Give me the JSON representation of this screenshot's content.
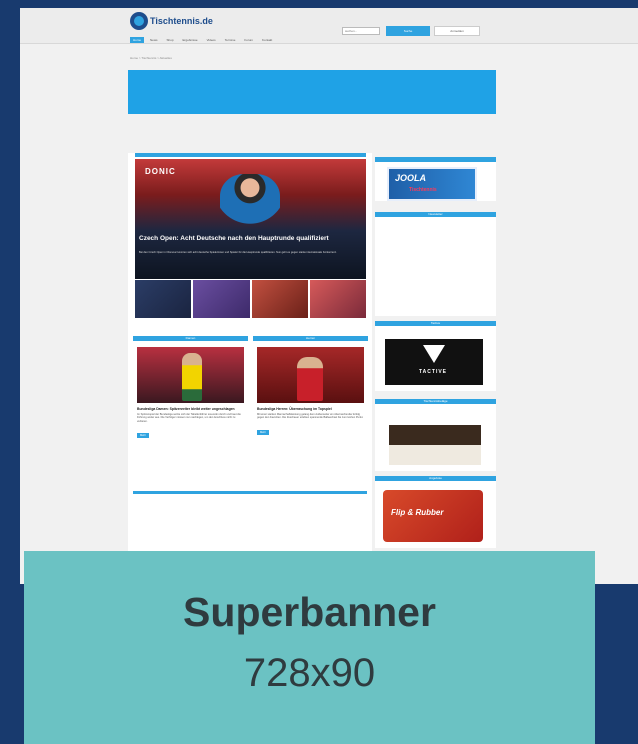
{
  "site": {
    "logo_text": "Tischtennis.de",
    "search_placeholder": "suchen...",
    "search_button": "Suche",
    "login_button": "Anmelden",
    "nav": [
      "Home",
      "News",
      "Shop",
      "Ergebnisse",
      "Videos",
      "Termine",
      "Forum",
      "Kontakt"
    ],
    "breadcrumb": "Home > Tischtennis > Aktuelles"
  },
  "hero": {
    "banner_text": "DONIC",
    "title": "Czech Open: Acht Deutsche nach den Hauptrunde qualifiziert",
    "text": "Bei den Czech Open in Olomouc konnten sich acht deutsche Spielerinnen und Spieler für die Hauptrunde qualifizieren. Nun geht es gegen starke internationale Konkurrenz."
  },
  "cards": [
    {
      "header": "Damen",
      "title": "Bundesliga Damen: Spitzenreiter bleibt weiter ungeschlagen",
      "text": "Im Spitzenspiel der Bundesliga setzte sich der Tabellenführer souverän durch und baut die Führung weiter aus. Die Verfolger müssen nun nachlegen, um den Anschluss nicht zu verlieren.",
      "more": "Mehr"
    },
    {
      "header": "Herren",
      "title": "Bundesliga Herren: Überraschung im Topspiel",
      "text": "Mit einer starken Mannschaftsleistung gelang dem Außenseiter ein überraschender Erfolg gegen den Favoriten. Die Zuschauer erlebten spannende Ballwechsel bis zum letzten Punkt.",
      "more": "Mehr"
    }
  ],
  "sidebar": {
    "headers": [
      "Newsletter",
      "Tactive",
      "Tischtennisbeläge",
      "Angebote",
      "Tischtennis Shop"
    ],
    "ads": {
      "joola_brand": "JOOLA",
      "joola_sub": "Tischtennis",
      "tactive_brand": "TACTIVE",
      "flip_text": "Flip & Rubber"
    }
  },
  "overlay": {
    "title": "Superbanner",
    "size": "728x90"
  },
  "colors": {
    "background": "#183a6e",
    "accent": "#2fa3e0",
    "overlay": "#6bc2c3"
  }
}
